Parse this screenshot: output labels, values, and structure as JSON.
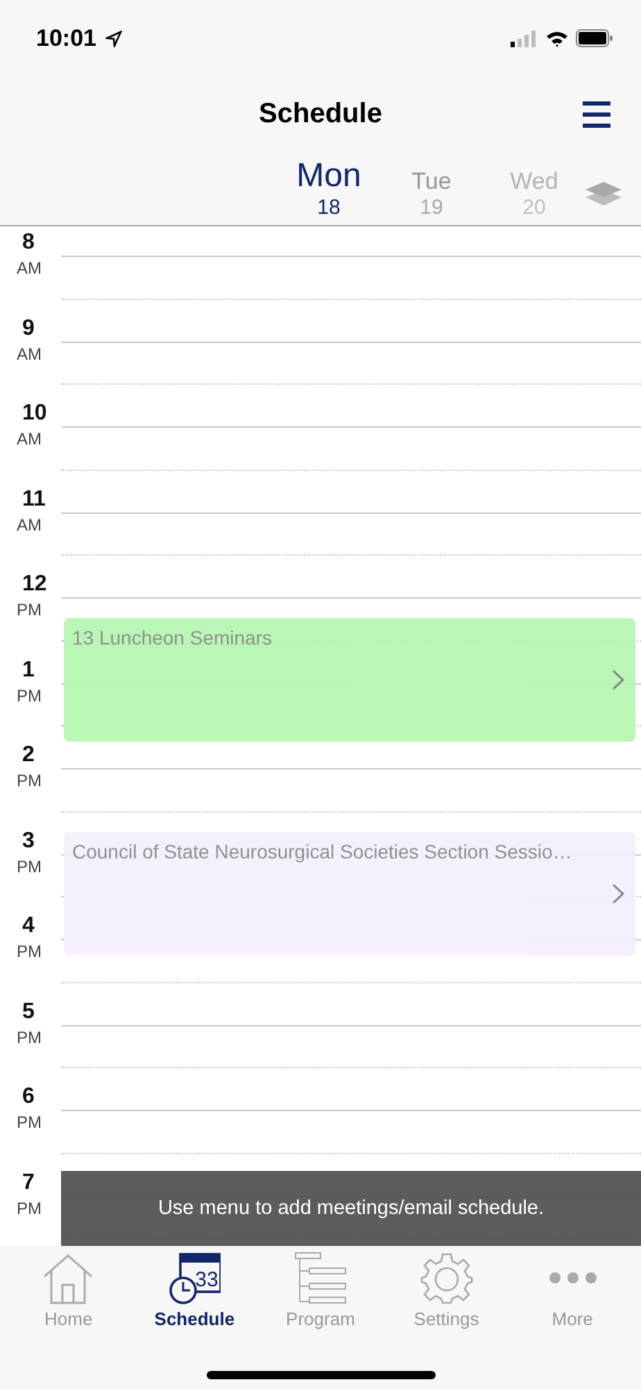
{
  "status_bar": {
    "time": "10:01"
  },
  "header": {
    "title": "Schedule"
  },
  "days": [
    {
      "name": "Mon",
      "date": "18",
      "selected": true
    },
    {
      "name": "Tue",
      "date": "19",
      "selected": false
    },
    {
      "name": "Wed",
      "date": "20",
      "selected": false
    }
  ],
  "hours": [
    {
      "hour": "8",
      "period": "AM"
    },
    {
      "hour": "9",
      "period": "AM"
    },
    {
      "hour": "10",
      "period": "AM"
    },
    {
      "hour": "11",
      "period": "AM"
    },
    {
      "hour": "12",
      "period": "PM"
    },
    {
      "hour": "1",
      "period": "PM"
    },
    {
      "hour": "2",
      "period": "PM"
    },
    {
      "hour": "3",
      "period": "PM"
    },
    {
      "hour": "4",
      "period": "PM"
    },
    {
      "hour": "5",
      "period": "PM"
    },
    {
      "hour": "6",
      "period": "PM"
    },
    {
      "hour": "7",
      "period": "PM"
    }
  ],
  "events": [
    {
      "title": "13 Luncheon Seminars",
      "color": "#b5f7b0"
    },
    {
      "title": "Council of State Neurosurgical Societies Section Sessio…",
      "color": "#f6effd"
    }
  ],
  "toast": "Use menu to add meetings/email schedule.",
  "tabs": [
    {
      "label": "Home",
      "kind": "home",
      "selected": false
    },
    {
      "label": "Schedule",
      "kind": "schedule",
      "selected": true,
      "icon_text": "33"
    },
    {
      "label": "Program",
      "kind": "program",
      "selected": false
    },
    {
      "label": "Settings",
      "kind": "settings",
      "selected": false
    },
    {
      "label": "More",
      "kind": "more",
      "selected": false
    }
  ]
}
